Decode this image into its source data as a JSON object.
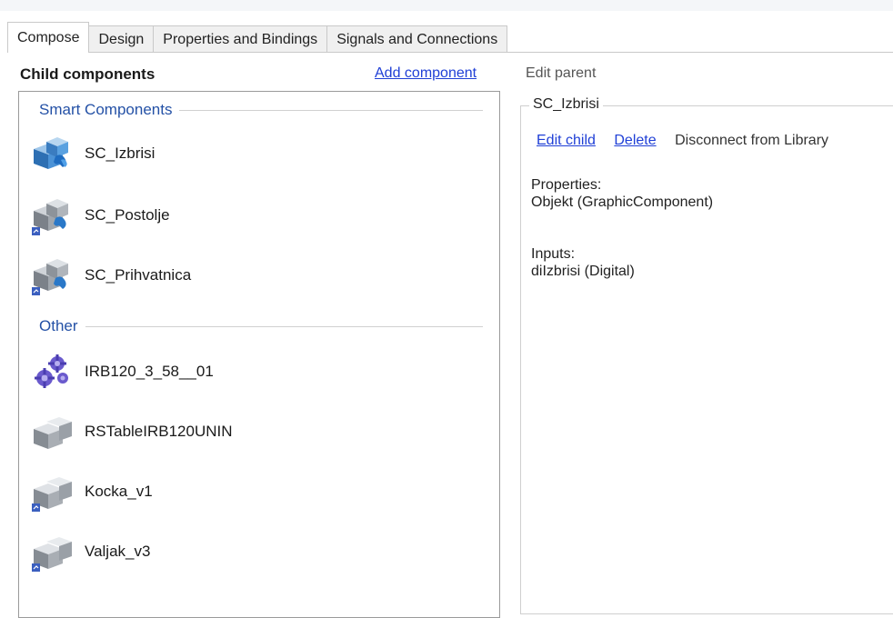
{
  "tabs": [
    {
      "label": "Compose",
      "active": true
    },
    {
      "label": "Design",
      "active": false
    },
    {
      "label": "Properties and Bindings",
      "active": false
    },
    {
      "label": "Signals and Connections",
      "active": false
    }
  ],
  "left_panel": {
    "title": "Child components",
    "add_link": "Add component",
    "groups": [
      {
        "label": "Smart Components",
        "items": [
          {
            "label": "SC_Izbrisi",
            "icon": "smart-component-icon"
          },
          {
            "label": "SC_Postolje",
            "icon": "smart-component-icon"
          },
          {
            "label": "SC_Prihvatnica",
            "icon": "smart-component-icon"
          }
        ]
      },
      {
        "label": "Other",
        "items": [
          {
            "label": "IRB120_3_58__01",
            "icon": "robot-mechanism-icon"
          },
          {
            "label": "RSTableIRB120UNIN",
            "icon": "part-icon"
          },
          {
            "label": "Kocka_v1",
            "icon": "part-icon"
          },
          {
            "label": "Valjak_v3",
            "icon": "part-icon"
          }
        ]
      }
    ]
  },
  "right_panel": {
    "edit_parent": "Edit parent",
    "selected_title": "SC_Izbrisi",
    "actions": {
      "edit_child": "Edit child",
      "delete": "Delete",
      "disconnect": "Disconnect from Library"
    },
    "properties_label": "Properties:",
    "properties_value": "Objekt (GraphicComponent)",
    "inputs_label": "Inputs:",
    "inputs_value": "diIzbrisi (Digital)"
  },
  "colors": {
    "link": "#1f3fd6",
    "group_header": "#2451a6",
    "smart_icon": "#2d7fc8"
  }
}
